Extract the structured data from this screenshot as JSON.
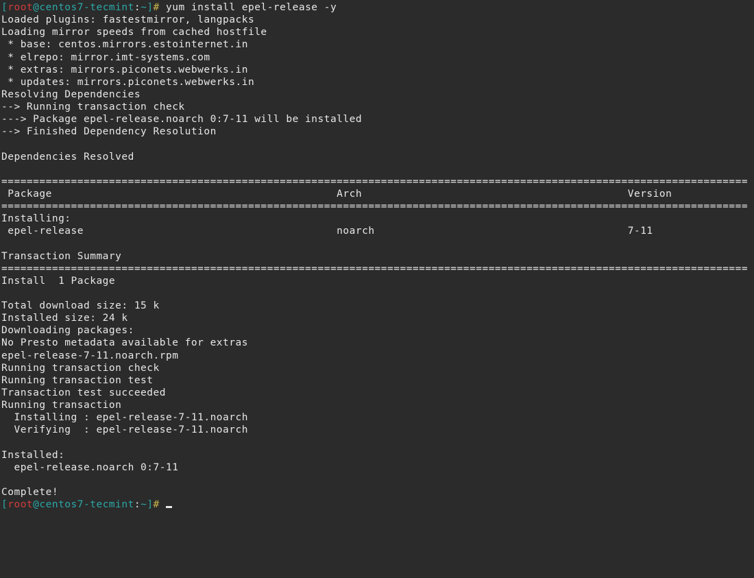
{
  "prompt1": {
    "br_open": "[",
    "user": "root",
    "at": "@",
    "host": "centos7-tecmint",
    "colon": ":",
    "cwd": "~",
    "br_close": "]",
    "hash": "# ",
    "command": "yum install epel-release -y"
  },
  "lines": {
    "l01": "Loaded plugins: fastestmirror, langpacks",
    "l02": "Loading mirror speeds from cached hostfile",
    "l03": " * base: centos.mirrors.estointernet.in",
    "l04": " * elrepo: mirror.imt-systems.com",
    "l05": " * extras: mirrors.piconets.webwerks.in",
    "l06": " * updates: mirrors.piconets.webwerks.in",
    "l07": "Resolving Dependencies",
    "l08": "--> Running transaction check",
    "l09": "---> Package epel-release.noarch 0:7-11 will be installed",
    "l10": "--> Finished Dependency Resolution",
    "l11": "",
    "l12": "Dependencies Resolved",
    "l13": "",
    "sep1": "======================================================================================================================",
    "hdr": " Package                                             Arch                                          Version",
    "sep2": "======================================================================================================================",
    "l14": "Installing:",
    "l15": " epel-release                                        noarch                                        7-11",
    "l16": "",
    "l17": "Transaction Summary",
    "sep3": "======================================================================================================================",
    "l18": "Install  1 Package",
    "l19": "",
    "l20": "Total download size: 15 k",
    "l21": "Installed size: 24 k",
    "l22": "Downloading packages:",
    "l23": "No Presto metadata available for extras",
    "l24": "epel-release-7-11.noarch.rpm",
    "l25": "Running transaction check",
    "l26": "Running transaction test",
    "l27": "Transaction test succeeded",
    "l28": "Running transaction",
    "l29": "  Installing : epel-release-7-11.noarch",
    "l30": "  Verifying  : epel-release-7-11.noarch",
    "l31": "",
    "l32": "Installed:",
    "l33": "  epel-release.noarch 0:7-11",
    "l34": "",
    "l35": "Complete!"
  },
  "prompt2": {
    "br_open": "[",
    "user": "root",
    "at": "@",
    "host": "centos7-tecmint",
    "colon": ":",
    "cwd": "~",
    "br_close": "]",
    "hash": "# "
  }
}
